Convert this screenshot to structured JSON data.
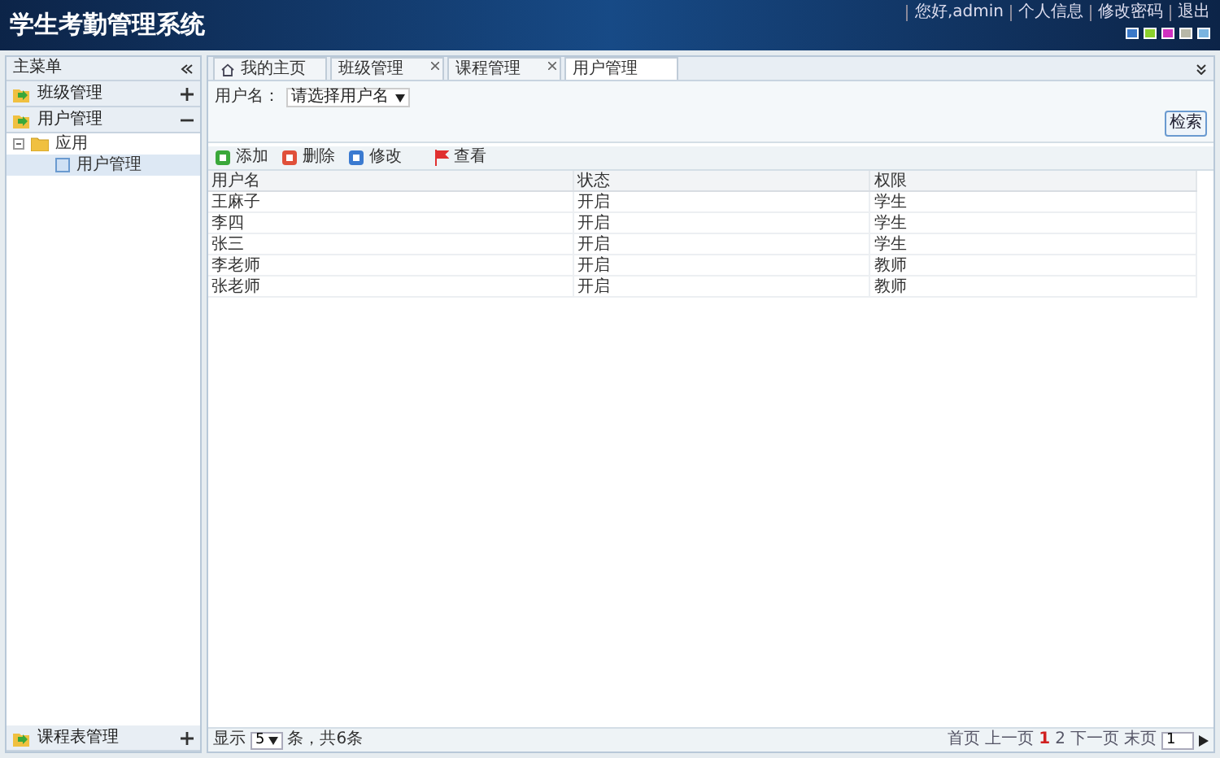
{
  "header": {
    "title": "学生考勤管理系统",
    "links": [
      "您好,admin",
      "个人信息",
      "修改密码",
      "退出"
    ],
    "themes": [
      {
        "color": "#3a78c8"
      },
      {
        "color": "#8cd02c"
      },
      {
        "color": "#d030c0"
      },
      {
        "color": "#b8b8a8"
      },
      {
        "color": "#7ab4e0"
      }
    ]
  },
  "sidebar": {
    "title": "主菜单",
    "sections": [
      {
        "label": "班级管理",
        "expanded": false
      },
      {
        "label": "用户管理",
        "expanded": true,
        "children": [
          {
            "label": "应用",
            "expanded": true,
            "selected": false,
            "children": [
              {
                "label": "用户管理",
                "selected": true
              }
            ]
          }
        ]
      }
    ],
    "bottom_sections": [
      {
        "label": "课程表管理",
        "expanded": false
      }
    ]
  },
  "tabs": [
    {
      "label": "我的主页",
      "kind": "home",
      "selected": false
    },
    {
      "label": "班级管理",
      "kind": "closable",
      "selected": false
    },
    {
      "label": "课程管理",
      "kind": "closable",
      "selected": false
    },
    {
      "label": "用户管理",
      "kind": "plain",
      "selected": true
    }
  ],
  "filter": {
    "label": "用户名：",
    "value": "请选择用户名",
    "button": "检索"
  },
  "toolbar": [
    {
      "label": "添加",
      "kind": "add"
    },
    {
      "label": "删除",
      "kind": "delete"
    },
    {
      "label": "修改",
      "kind": "edit"
    },
    {
      "label": "查看",
      "kind": "view"
    }
  ],
  "table": {
    "columns": [
      "用户名",
      "状态",
      "权限"
    ],
    "rows": [
      [
        "王麻子",
        "开启",
        "学生"
      ],
      [
        "李四",
        "开启",
        "学生"
      ],
      [
        "张三",
        "开启",
        "学生"
      ],
      [
        "李老师",
        "开启",
        "教师"
      ],
      [
        "张老师",
        "开启",
        "教师"
      ]
    ]
  },
  "pager": {
    "show_label": "显示",
    "page_size": "5",
    "summary": "条，共6条",
    "first": "首页",
    "prev": "上一页",
    "pages": [
      {
        "label": "1",
        "selected": true
      },
      {
        "label": "2",
        "selected": false
      }
    ],
    "next": "下一页",
    "last": "末页",
    "jump": "1"
  }
}
